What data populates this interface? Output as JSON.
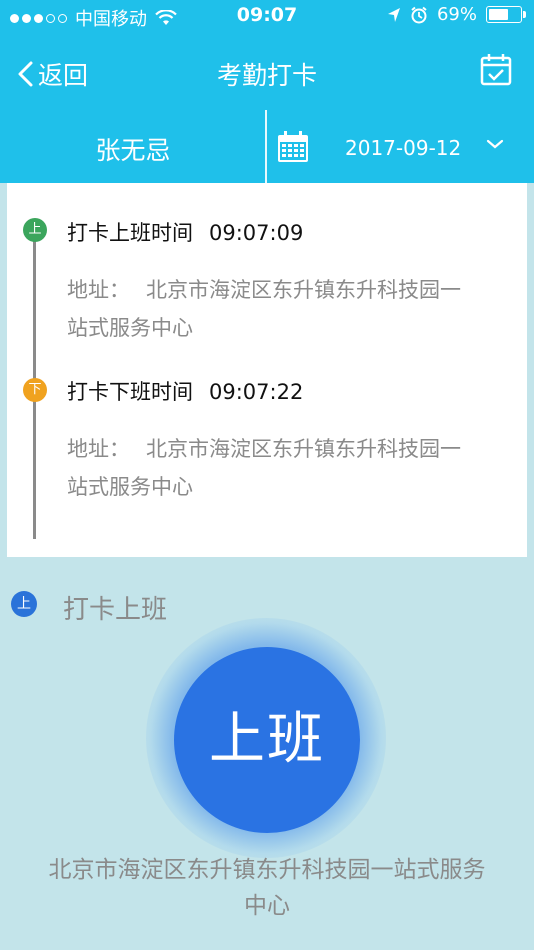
{
  "status_bar": {
    "carrier": "中国移动",
    "time": "09:07",
    "battery": "69%",
    "battery_level": 0.69
  },
  "nav": {
    "back_label": "返回",
    "title": "考勤打卡"
  },
  "subheader": {
    "employee_name": "张无忌",
    "date": "2017-09-12"
  },
  "records": [
    {
      "badge": "上",
      "title": "打卡上班时间",
      "time": "09:07:09",
      "address_label": "地址：",
      "address": "北京市海淀区东升镇东升科技园一站式服务中心"
    },
    {
      "badge": "下",
      "title": "打卡下班时间",
      "time": "09:07:22",
      "address_label": "地址：",
      "address": "北京市海淀区东升镇东升科技园一站式服务中心"
    }
  ],
  "punch": {
    "section_badge": "上",
    "section_title": "打卡上班",
    "button_label": "上班",
    "location": "北京市海淀区东升镇东升科技园一站式服务中心"
  },
  "colors": {
    "header": "#1fc0ea",
    "background": "#c3e4ea",
    "on_duty_badge": "#3ba55c",
    "off_duty_badge": "#f0a21f",
    "punch_button": "#2a73e3"
  }
}
